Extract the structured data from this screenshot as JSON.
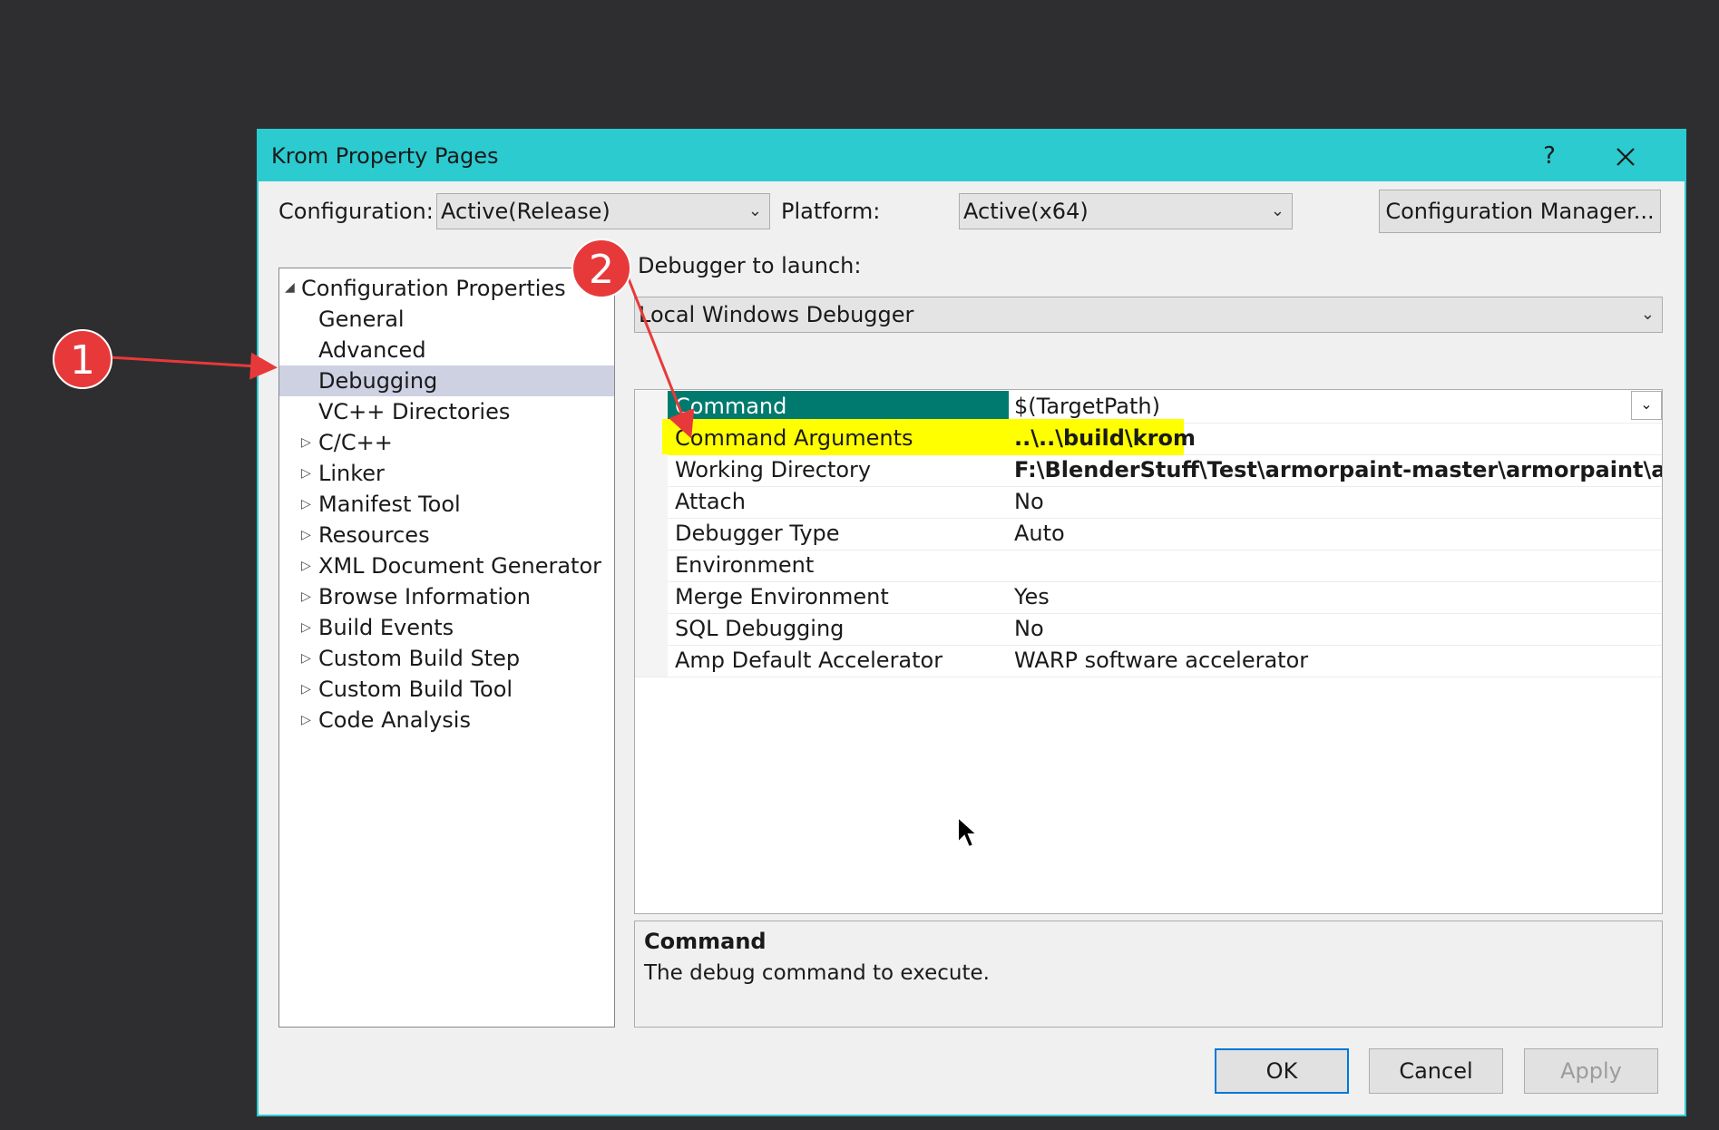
{
  "dialog": {
    "title": "Krom Property Pages",
    "help_label": "?",
    "close_label": "✕"
  },
  "config": {
    "config_label": "Configuration:",
    "config_value": "Active(Release)",
    "platform_label": "Platform:",
    "platform_value": "Active(x64)",
    "manager_button": "Configuration Manager..."
  },
  "tree": {
    "root": "Configuration Properties",
    "items": [
      {
        "label": "General",
        "expandable": false
      },
      {
        "label": "Advanced",
        "expandable": false
      },
      {
        "label": "Debugging",
        "expandable": false,
        "selected": true
      },
      {
        "label": "VC++ Directories",
        "expandable": false
      },
      {
        "label": "C/C++",
        "expandable": true
      },
      {
        "label": "Linker",
        "expandable": true
      },
      {
        "label": "Manifest Tool",
        "expandable": true
      },
      {
        "label": "Resources",
        "expandable": true
      },
      {
        "label": "XML Document Generator",
        "expandable": true
      },
      {
        "label": "Browse Information",
        "expandable": true
      },
      {
        "label": "Build Events",
        "expandable": true
      },
      {
        "label": "Custom Build Step",
        "expandable": true
      },
      {
        "label": "Custom Build Tool",
        "expandable": true
      },
      {
        "label": "Code Analysis",
        "expandable": true
      }
    ]
  },
  "debugger": {
    "label": "Debugger to launch:",
    "value": "Local Windows Debugger"
  },
  "properties": [
    {
      "name": "Command",
      "value": "$(TargetPath)",
      "bold": false,
      "state": "selected"
    },
    {
      "name": "Command Arguments",
      "value": "..\\..\\build\\krom",
      "bold": true,
      "state": "highlight"
    },
    {
      "name": "Working Directory",
      "value": "F:\\BlenderStuff\\Test\\armorpaint-master\\armorpaint\\armorcore",
      "bold": true,
      "state": ""
    },
    {
      "name": "Attach",
      "value": "No",
      "bold": false,
      "state": ""
    },
    {
      "name": "Debugger Type",
      "value": "Auto",
      "bold": false,
      "state": ""
    },
    {
      "name": "Environment",
      "value": "",
      "bold": false,
      "state": ""
    },
    {
      "name": "Merge Environment",
      "value": "Yes",
      "bold": false,
      "state": ""
    },
    {
      "name": "SQL Debugging",
      "value": "No",
      "bold": false,
      "state": ""
    },
    {
      "name": "Amp Default Accelerator",
      "value": "WARP software accelerator",
      "bold": false,
      "state": ""
    }
  ],
  "description": {
    "title": "Command",
    "text": "The debug command to execute."
  },
  "buttons": {
    "ok": "OK",
    "cancel": "Cancel",
    "apply": "Apply"
  },
  "annotations": {
    "badge1": "1",
    "badge2": "2",
    "color": "#e8393a"
  },
  "colors": {
    "titlebar": "#2bcbd0",
    "selected_row": "#007a6e",
    "highlight": "#ffff00",
    "tree_selected": "#cdd1e1"
  }
}
